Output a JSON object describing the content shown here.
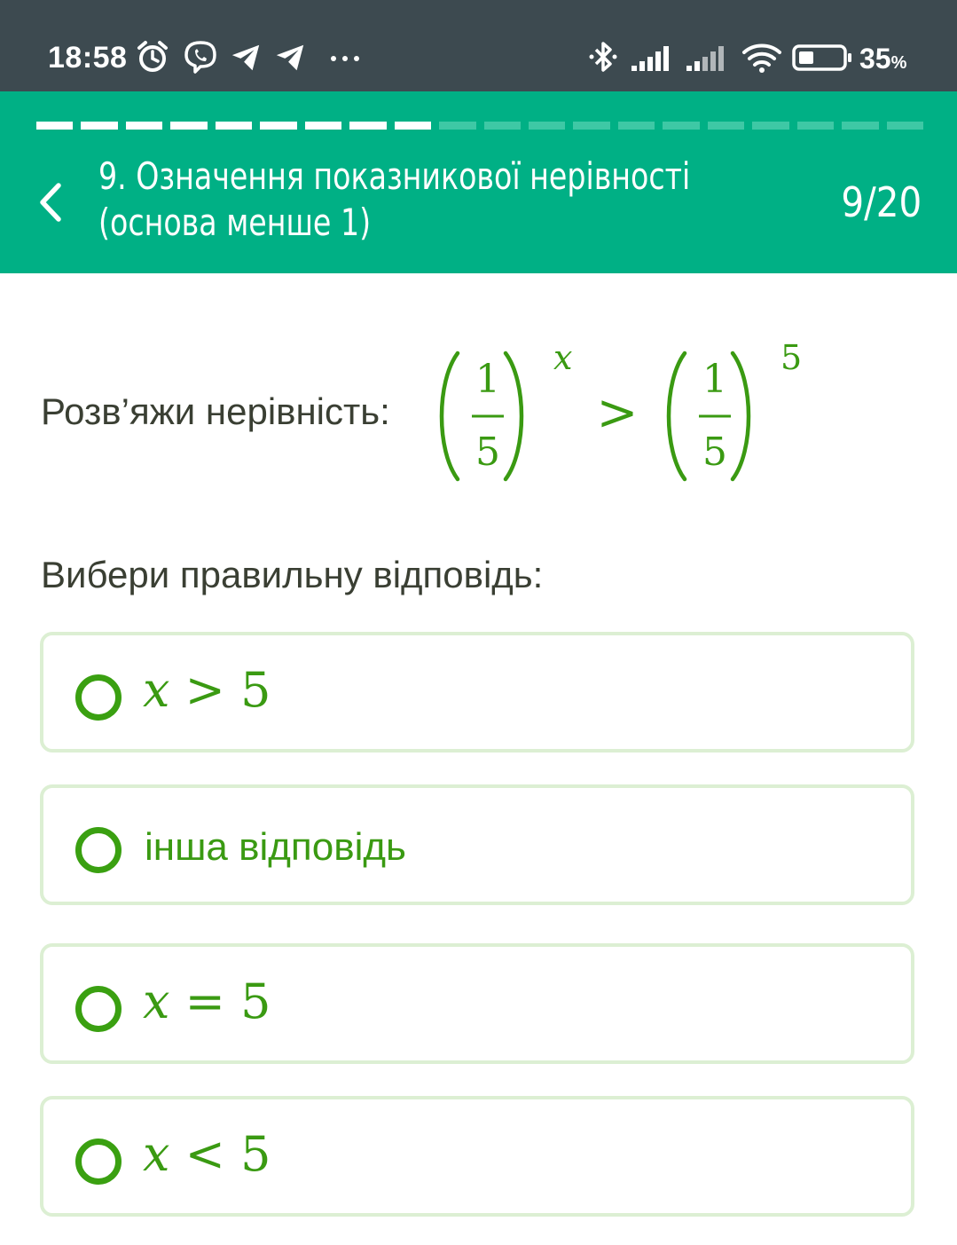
{
  "status_bar": {
    "time": "18:58",
    "battery": "35",
    "battery_unit": "%",
    "icons": [
      "alarm-icon",
      "viber-icon",
      "telegram-icon",
      "telegram-icon",
      "more-notifications-icon",
      "bluetooth-icon",
      "signal-icon",
      "signal-icon",
      "wifi-icon",
      "battery-icon"
    ]
  },
  "progress": {
    "total": 20,
    "current": 9
  },
  "header": {
    "title_line1": "9. Означення показникової нерівності",
    "title_line2": "(основа менше 1)",
    "counter": "9/20"
  },
  "question": {
    "label": "Розв’яжи нерівність:",
    "formula": {
      "left_base_num": "1",
      "left_base_den": "5",
      "left_exp": "x",
      "operator": ">",
      "right_base_num": "1",
      "right_base_den": "5",
      "right_exp": "5"
    }
  },
  "prompt": "Вибери правильну відповідь:",
  "options": [
    {
      "var": "x",
      "op": ">",
      "val": "5"
    },
    {
      "text": "інша відповідь"
    },
    {
      "var": "x",
      "op": "=",
      "val": "5"
    },
    {
      "var": "x",
      "op": "<",
      "val": "5"
    }
  ],
  "colors": {
    "status_bar": "#3d4a50",
    "header": "#00b085",
    "accent_green": "#3a9a12",
    "option_border": "#dcefd3",
    "text_dark": "#3a3f33"
  }
}
